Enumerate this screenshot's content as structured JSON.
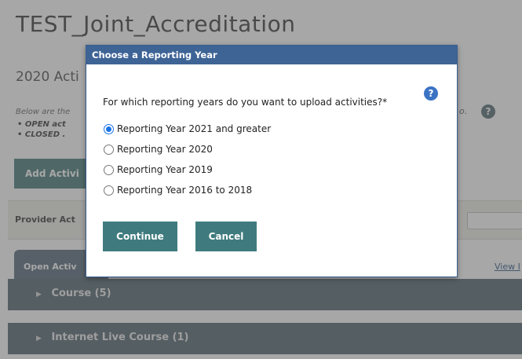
{
  "page": {
    "title": "TEST_Joint_Accreditation",
    "subtitle": "2020 Acti",
    "description": "Below are the",
    "bullets": [
      "• OPEN act",
      "• CLOSED ."
    ],
    "trail_text": "o.",
    "add_activity_label": "Add Activi",
    "provider_label": "Provider Act",
    "tab_open_label": "Open Activ",
    "view_link": "View I",
    "accordions": [
      {
        "label": "Course (5)"
      },
      {
        "label": "Internet Live Course (1)"
      }
    ]
  },
  "dialog": {
    "title": "Choose a Reporting Year",
    "question": "For which reporting years do you want to upload activities?*",
    "options": [
      {
        "label": "Reporting Year 2021 and greater",
        "checked": true
      },
      {
        "label": "Reporting Year 2020",
        "checked": false
      },
      {
        "label": "Reporting Year 2019",
        "checked": false
      },
      {
        "label": "Reporting Year 2016 to 2018",
        "checked": false
      }
    ],
    "continue_label": "Continue",
    "cancel_label": "Cancel"
  },
  "icons": {
    "help": "?",
    "chevron": "▶"
  },
  "colors": {
    "dialog_titlebar": "#3e6496",
    "primary_button": "#3f7b7e",
    "help_icon": "#3b73c4",
    "accordion": "#6a7a84"
  }
}
